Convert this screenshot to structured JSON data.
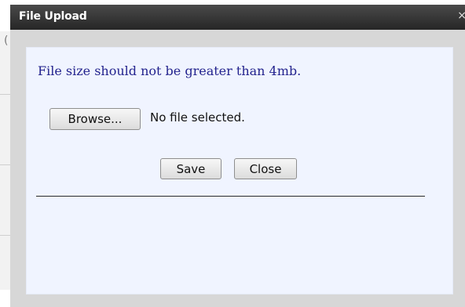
{
  "dialog": {
    "title": "File Upload",
    "close_glyph": "×",
    "info_text": "File size should not be greater than 4mb.",
    "browse_label": "Browse...",
    "file_status": "No file selected.",
    "save_label": "Save",
    "close_label": "Close"
  },
  "background": {
    "glyph": "("
  },
  "colors": {
    "titlebar": "#333333",
    "content_bg": "#f0f4ff",
    "info_text": "#23238e",
    "dialog_frame": "#d7d7d7"
  }
}
